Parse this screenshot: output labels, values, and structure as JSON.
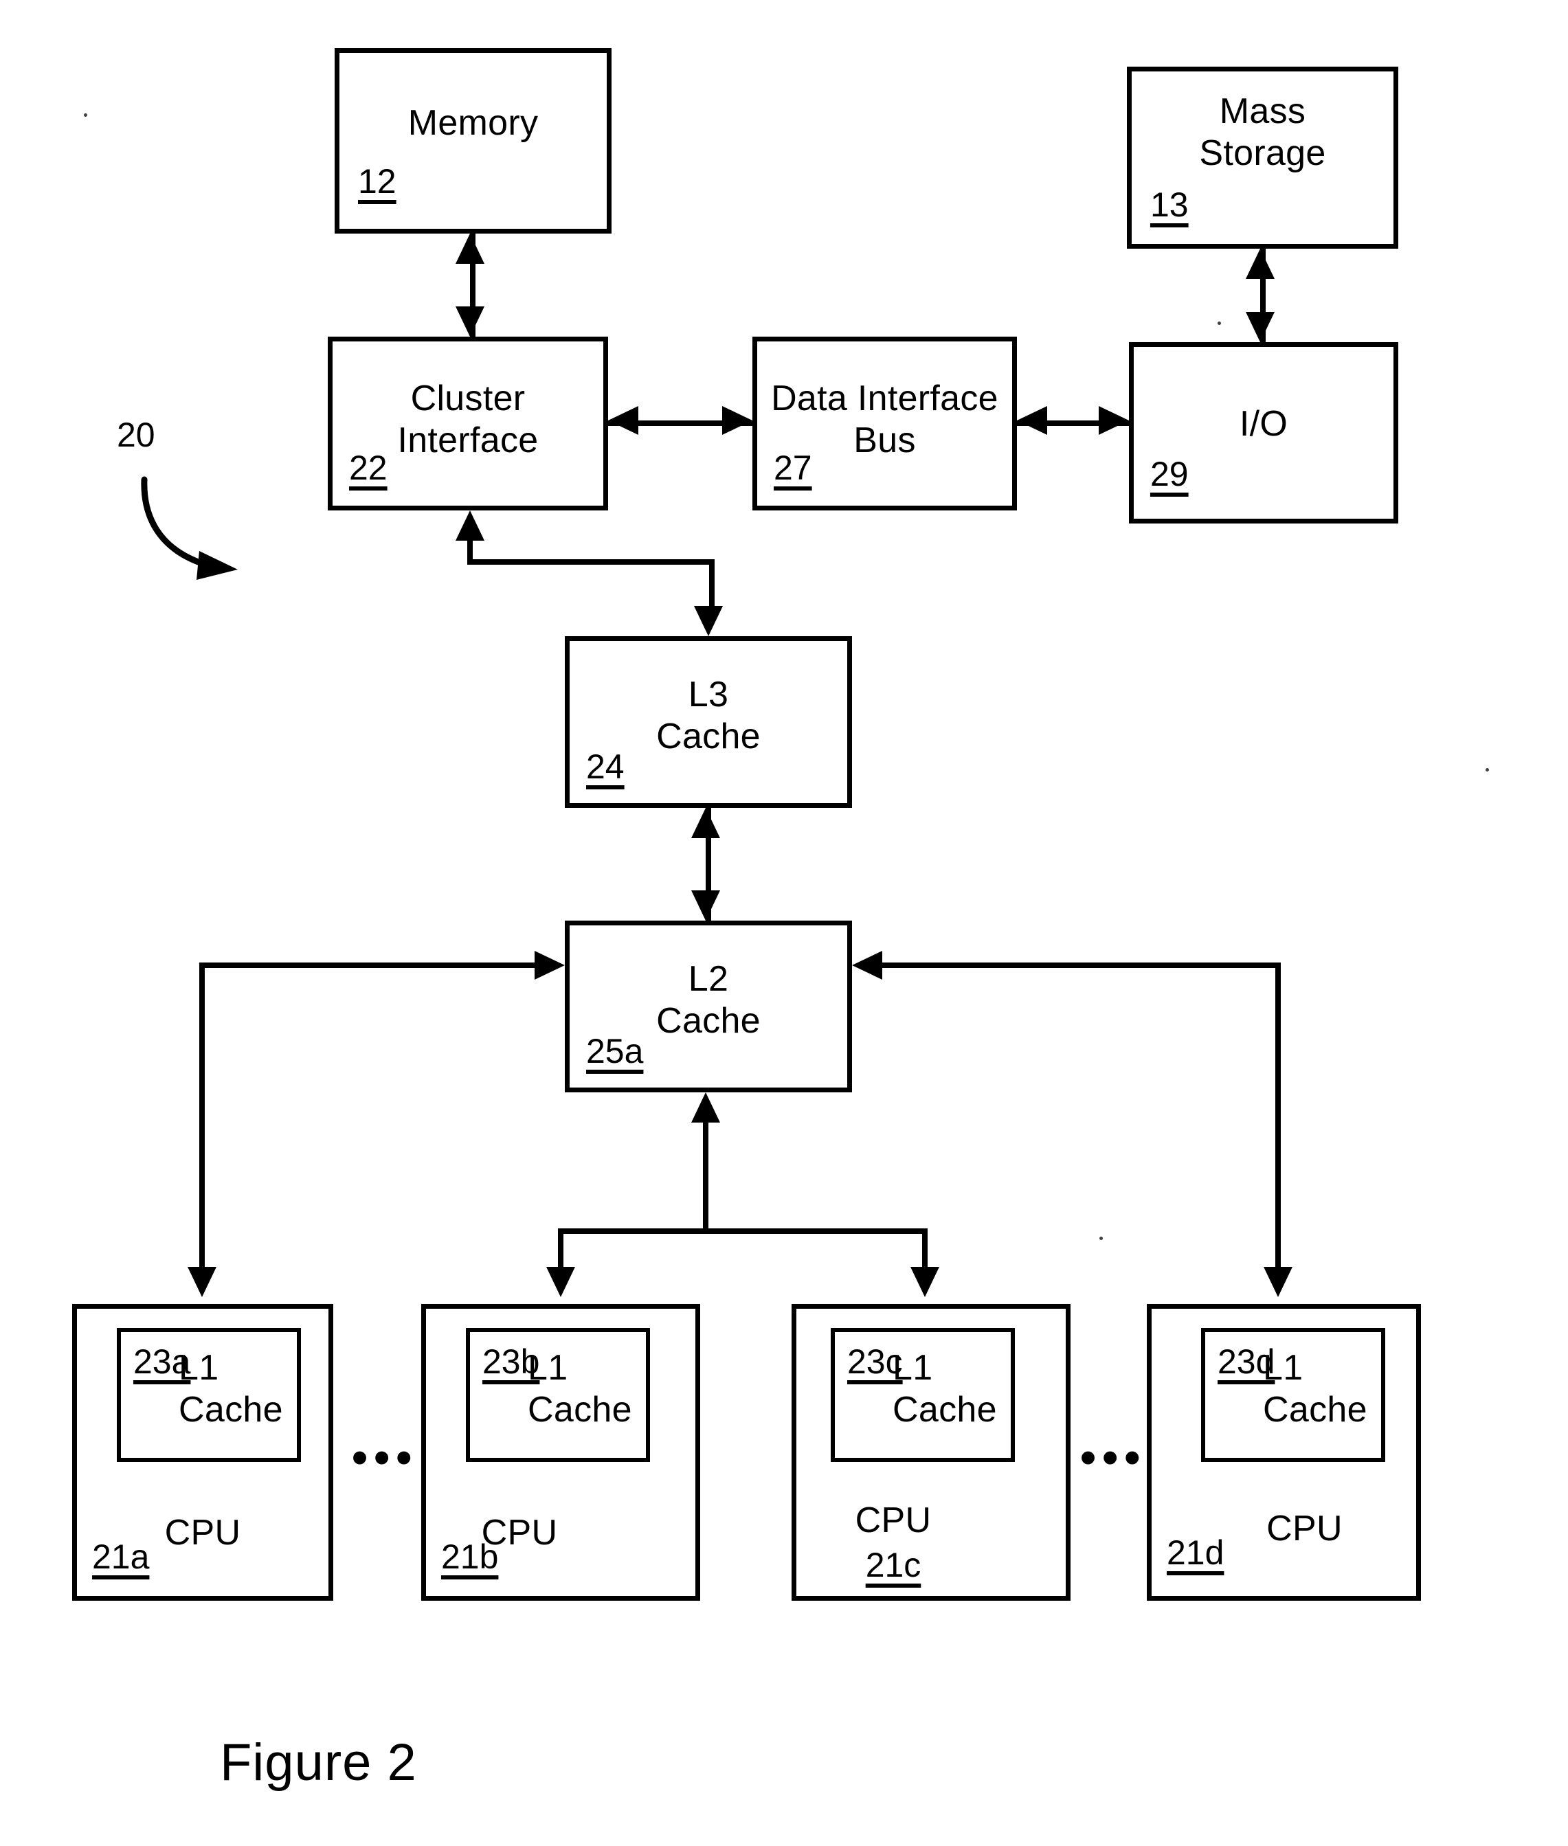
{
  "figure": {
    "caption": "Figure 2",
    "system_reference": "20"
  },
  "blocks": {
    "memory": {
      "label": "Memory",
      "ref": "12"
    },
    "mass_storage": {
      "label": "Mass\nStorage",
      "ref": "13"
    },
    "cluster_interface": {
      "label": "Cluster\nInterface",
      "ref": "22"
    },
    "data_interface_bus": {
      "label": "Data Interface\nBus",
      "ref": "27"
    },
    "io": {
      "label": "I/O",
      "ref": "29"
    },
    "l3_cache": {
      "label": "L3\nCache",
      "ref": "24"
    },
    "l2_cache": {
      "label": "L2\nCache",
      "ref": "25a"
    }
  },
  "cpus": [
    {
      "label": "CPU",
      "ref": "21a",
      "cache_label": "L1\nCache",
      "cache_ref": "23a"
    },
    {
      "label": "CPU",
      "ref": "21b",
      "cache_label": "L1\nCache",
      "cache_ref": "23b"
    },
    {
      "label": "CPU",
      "ref": "21c",
      "cache_label": "L1\nCache",
      "cache_ref": "23c"
    },
    {
      "label": "CPU",
      "ref": "21d",
      "cache_label": "L1\nCache",
      "cache_ref": "23d"
    }
  ],
  "ellipses": {
    "first": "•••",
    "second": "•••"
  },
  "colors": {
    "stroke": "#000000",
    "background": "#ffffff"
  }
}
